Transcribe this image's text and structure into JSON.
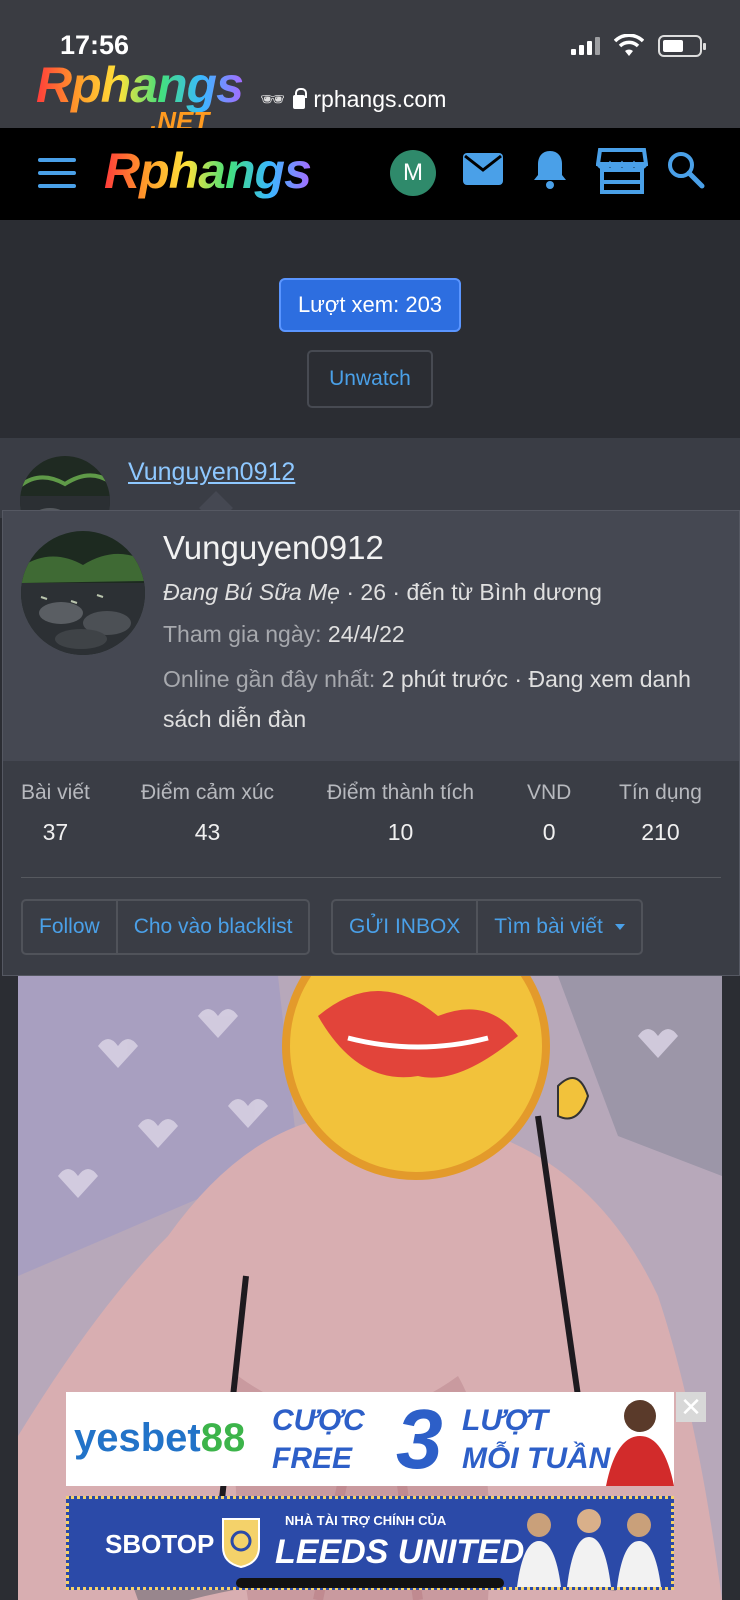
{
  "status_bar": {
    "time": "17:56"
  },
  "address_bar": {
    "watermark": "Rphangs",
    "watermark_suffix": ".NET",
    "url": "rphangs.com"
  },
  "nav": {
    "logo": "Rphangs",
    "avatar_letter": "M"
  },
  "page": {
    "views_label": "Lượt xem: 203",
    "unwatch_label": "Unwatch"
  },
  "post": {
    "username": "Vunguyen0912"
  },
  "profile_card": {
    "name": "Vunguyen0912",
    "title": "Đang Bú Sữa Mẹ",
    "age": "26",
    "location": "đến từ Bình dương",
    "joined_label": "Tham gia ngày:",
    "joined_value": "24/4/22",
    "last_seen_label": "Online gần đây nhất:",
    "last_seen_value": "2 phút trước · Đang xem danh sách diễn đàn",
    "stats": [
      {
        "label": "Bài viết",
        "value": "37"
      },
      {
        "label": "Điểm cảm xúc",
        "value": "43"
      },
      {
        "label": "Điểm thành tích",
        "value": "10"
      },
      {
        "label": "VND",
        "value": "0"
      },
      {
        "label": "Tín dụng",
        "value": "210"
      }
    ],
    "buttons": {
      "follow": "Follow",
      "blacklist": "Cho vào blacklist",
      "inbox": "GỬI INBOX",
      "find_posts": "Tìm bài viết"
    }
  },
  "ads": {
    "ad1": {
      "brand": "yesbet",
      "brand_num": "88",
      "line1a": "CƯỢC",
      "line1b": "FREE",
      "big": "3",
      "line2a": "LƯỢT",
      "line2b": "MỖI TUẦN",
      "close": "✕"
    },
    "ad2": {
      "brand": "SBOTOP",
      "sub": "NHÀ TÀI TRỢ CHÍNH CỦA",
      "team": "LEEDS UNITED"
    }
  },
  "colors": {
    "accent": "#4aa0e8",
    "primary_button": "#2d6ee0",
    "background": "#2b2d33"
  }
}
